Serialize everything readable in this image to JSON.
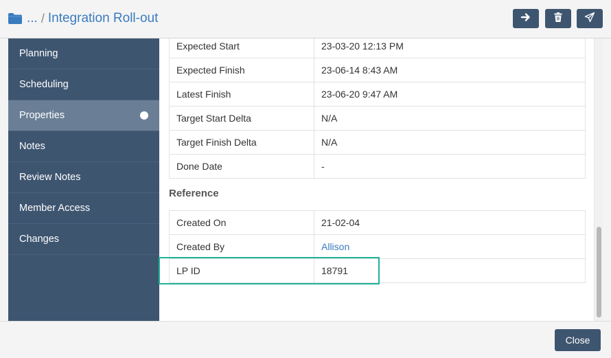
{
  "header": {
    "breadcrumb_ellipsis": "...",
    "breadcrumb_sep": "/",
    "title": "Integration Roll-out",
    "buttons": {
      "move": "arrow-right-icon",
      "delete": "trash-icon",
      "send": "send-icon"
    }
  },
  "sidebar": {
    "items": [
      {
        "label": "Planning"
      },
      {
        "label": "Scheduling"
      },
      {
        "label": "Properties",
        "active": true
      },
      {
        "label": "Notes"
      },
      {
        "label": "Review Notes"
      },
      {
        "label": "Member Access"
      },
      {
        "label": "Changes"
      }
    ]
  },
  "dates": [
    {
      "label": "Expected Start",
      "value": "23-03-20 12:13 PM"
    },
    {
      "label": "Expected Finish",
      "value": "23-06-14 8:43 AM"
    },
    {
      "label": "Latest Finish",
      "value": "23-06-20 9:47 AM"
    },
    {
      "label": "Target Start Delta",
      "value": "N/A"
    },
    {
      "label": "Target Finish Delta",
      "value": "N/A"
    },
    {
      "label": "Done Date",
      "value": "-"
    }
  ],
  "reference": {
    "title": "Reference",
    "rows": [
      {
        "label": "Created On",
        "value": "21-02-04"
      },
      {
        "label": "Created By",
        "value": "Allison"
      },
      {
        "label": "LP ID",
        "value": "18791"
      }
    ]
  },
  "footer": {
    "close_label": "Close"
  },
  "colors": {
    "sidebar": "#3e5570",
    "sidebar_active": "#6a7f96",
    "link": "#3a7bbf",
    "highlight": "#1fb29a"
  }
}
